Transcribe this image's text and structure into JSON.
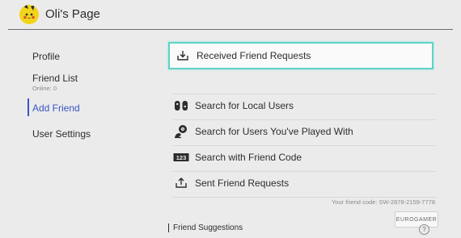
{
  "header": {
    "title": "Oli's Page",
    "avatar_icon": "pikachu-avatar-icon"
  },
  "sidebar": {
    "items": [
      {
        "label": "Profile"
      },
      {
        "label": "Friend List",
        "sub": "Online: 0"
      },
      {
        "label": "Add Friend",
        "active": true
      },
      {
        "label": "User Settings"
      }
    ]
  },
  "main": {
    "options": [
      {
        "label": "Received Friend Requests",
        "icon": "inbox-download-icon",
        "selected": true
      },
      {
        "label": "Search for Local Users",
        "icon": "joycons-icon"
      },
      {
        "label": "Search for Users You've Played With",
        "icon": "played-with-icon"
      },
      {
        "label": "Search with Friend Code",
        "icon": "friend-code-icon"
      },
      {
        "label": "Sent Friend Requests",
        "icon": "outbox-upload-icon"
      }
    ],
    "friend_code_text": "Your friend code: SW-2878-2159-7778",
    "suggestions_label": "Friend Suggestions"
  },
  "watermark": "EUROGAMER",
  "help_glyph": "?",
  "colors": {
    "accent": "#3a54c6",
    "selection_border": "#5fd3c6",
    "background": "#ebebeb"
  }
}
